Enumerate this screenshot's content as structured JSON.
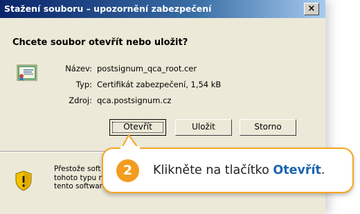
{
  "dialog": {
    "title": "Stažení souboru – upozornění zabezpečení",
    "close_glyph": "×",
    "question": "Chcete soubor otevřít nebo uložit?",
    "icon": "certificate-icon",
    "fields": {
      "name_label": "Název:",
      "name_value": "postsignum_qca_root.cer",
      "type_label": "Typ:",
      "type_value": "Certifikát zabezpečení, 1,54 kB",
      "source_label": "Zdroj:",
      "source_value": "qca.postsignum.cz"
    },
    "buttons": {
      "open": "Otevřít",
      "save": "Uložit",
      "cancel": "Storno"
    },
    "warning": {
      "icon": "shield-warning-icon",
      "line1": "Přestože soft",
      "line2": "tohoto typu mů",
      "line3": "tento software n"
    }
  },
  "callout": {
    "step": "2",
    "text_prefix": "Klikněte na tlačítko",
    "text_strong": "Otevřít",
    "text_suffix": ".",
    "accent": "#f39c1f",
    "link_color": "#1a64b0"
  }
}
